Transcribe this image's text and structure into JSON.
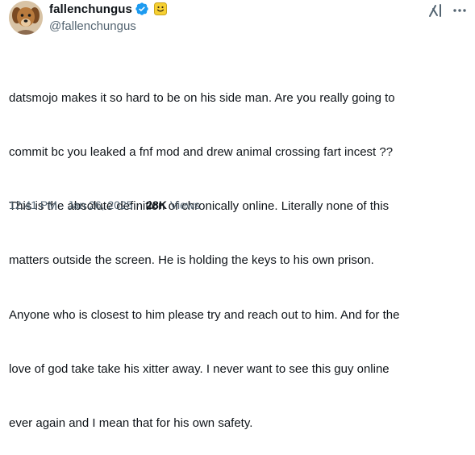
{
  "author": {
    "display_name": "fallenchungus",
    "handle": "@fallenchungus",
    "verified": true,
    "badge_emoji": "smiling-face-emoji"
  },
  "icons": {
    "verified": "verified-badge-icon",
    "grok": "grok-icon",
    "more": "more-options-icon",
    "avatar": "dog-photo-avatar"
  },
  "colors": {
    "verified_blue": "#1d9bf0",
    "text_primary": "#0f1419",
    "text_secondary": "#536471",
    "badge_yellow": "#f6d032"
  },
  "tweet": {
    "lines": [
      "datsmojo makes it so hard to be on his side man. Are you really going to",
      "commit bc you leaked a fnf mod and drew animal crossing fart incest ??",
      "This is the absolute definition of chronically online. Literally none of this",
      "matters outside the screen. He is holding the keys to his own prison.",
      "Anyone who is closest to him please try and reach out to him. And for the",
      "love of god take take his xitter away. I never want to see this guy online",
      "ever again and I mean that for his own safety."
    ]
  },
  "meta": {
    "time": "12:41 PM",
    "separator": "·",
    "date": "Jan 26, 2025",
    "views_count": "28K",
    "views_label": "Views"
  }
}
